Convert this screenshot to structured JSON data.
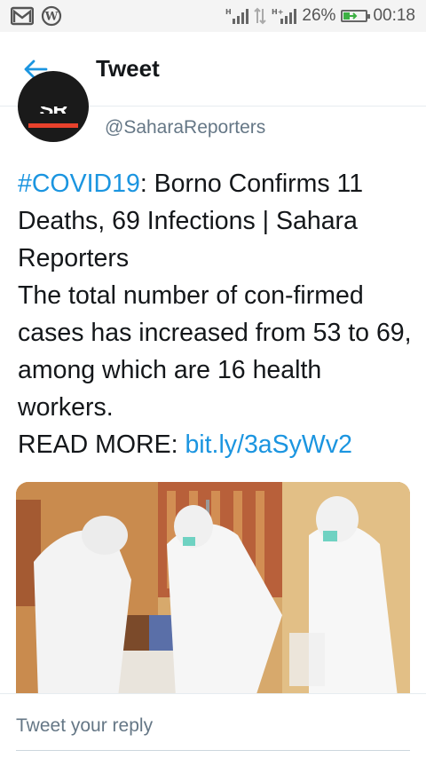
{
  "status_bar": {
    "battery_percent_label": "26%",
    "battery_level": 0.26,
    "time": "00:18",
    "icons": [
      "gmail-icon",
      "wordpress-icon",
      "signal-icon",
      "data-transfer-icon",
      "signal-hplus-icon",
      "battery-charging-icon"
    ]
  },
  "header": {
    "back_icon": "arrow-left-icon",
    "title": "Tweet"
  },
  "author": {
    "handle": "@SaharaReporters",
    "avatar_initials": "SR"
  },
  "tweet": {
    "hashtag": "#COVID19",
    "line1_rest": ": Borno Confirms 11 Deaths, 69 Infections | Sahara Reporters",
    "body": "The total number of con-firmed cases has increased from 53 to 69, among which are 16 health workers.",
    "read_more_label": "READ MORE: ",
    "link": "bit.ly/3aSyWv2"
  },
  "reply": {
    "placeholder": "Tweet your reply"
  },
  "colors": {
    "accent": "#1b95e0",
    "text": "#14171a",
    "muted": "#657786",
    "avatar_bar": "#e8412c"
  }
}
